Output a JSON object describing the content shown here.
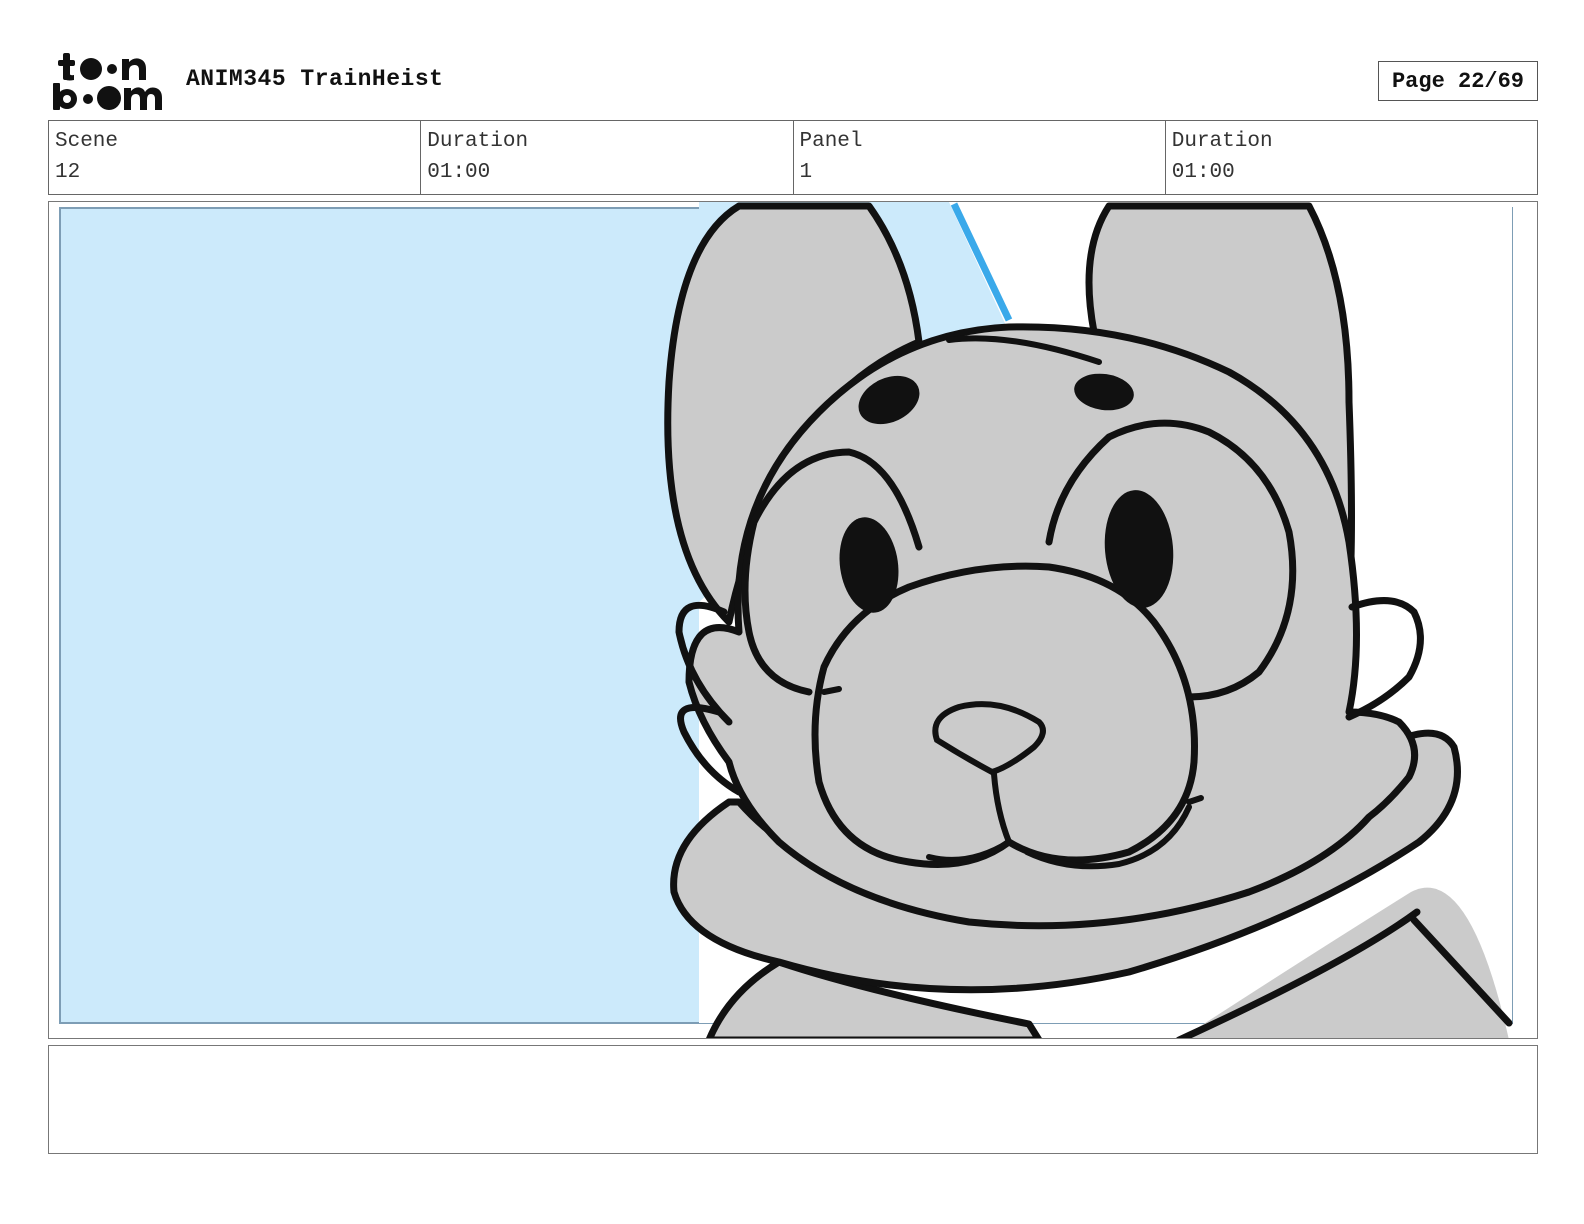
{
  "header": {
    "logo_icon": "toonboom-logo",
    "project_title": "ANIM345 TrainHeist",
    "page_label": "Page 22/69"
  },
  "info": {
    "scene_label": "Scene",
    "scene_value": "12",
    "scene_duration_label": "Duration",
    "scene_duration_value": "01:00",
    "panel_label": "Panel",
    "panel_value": "1",
    "panel_duration_label": "Duration",
    "panel_duration_value": "01:00"
  },
  "panel_image": {
    "description_icon": "character-sketch-icon",
    "background_color": "#cceafb",
    "fill_color": "#cbcbcb",
    "accent_line_color": "#3aa9ea"
  },
  "notes": {
    "text": ""
  }
}
